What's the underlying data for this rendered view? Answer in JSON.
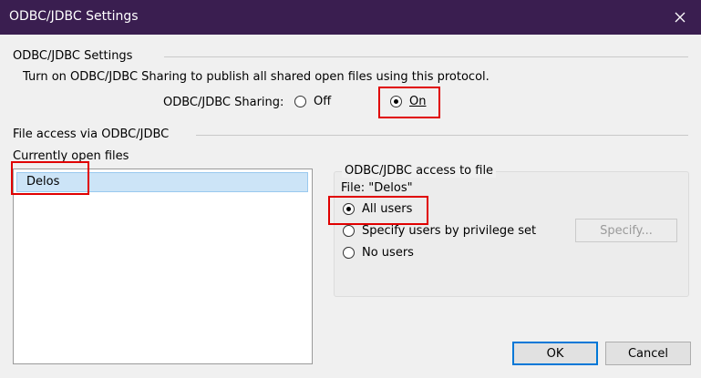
{
  "window": {
    "title": "ODBC/JDBC Settings"
  },
  "settings": {
    "group_label": "ODBC/JDBC Settings",
    "description": "Turn on ODBC/JDBC Sharing to publish all shared open files using this protocol.",
    "sharing_label": "ODBC/JDBC Sharing:",
    "off_label": "Off",
    "on_label": "On",
    "selected": "On"
  },
  "file_access": {
    "group_label": "File access via ODBC/JDBC",
    "open_files_label": "Currently open files",
    "files": [
      "Delos"
    ],
    "selected_file": "Delos"
  },
  "access": {
    "group_label": "ODBC/JDBC access to file",
    "file_label": "File: \"Delos\"",
    "all_users": "All users",
    "by_privilege": "Specify users by privilege set",
    "no_users": "No users",
    "selected": "All users",
    "specify_button": "Specify..."
  },
  "buttons": {
    "ok": "OK",
    "cancel": "Cancel"
  },
  "colors": {
    "titlebar": "#3a1e50",
    "highlight": "#e00000",
    "selection": "#cce4f7"
  }
}
